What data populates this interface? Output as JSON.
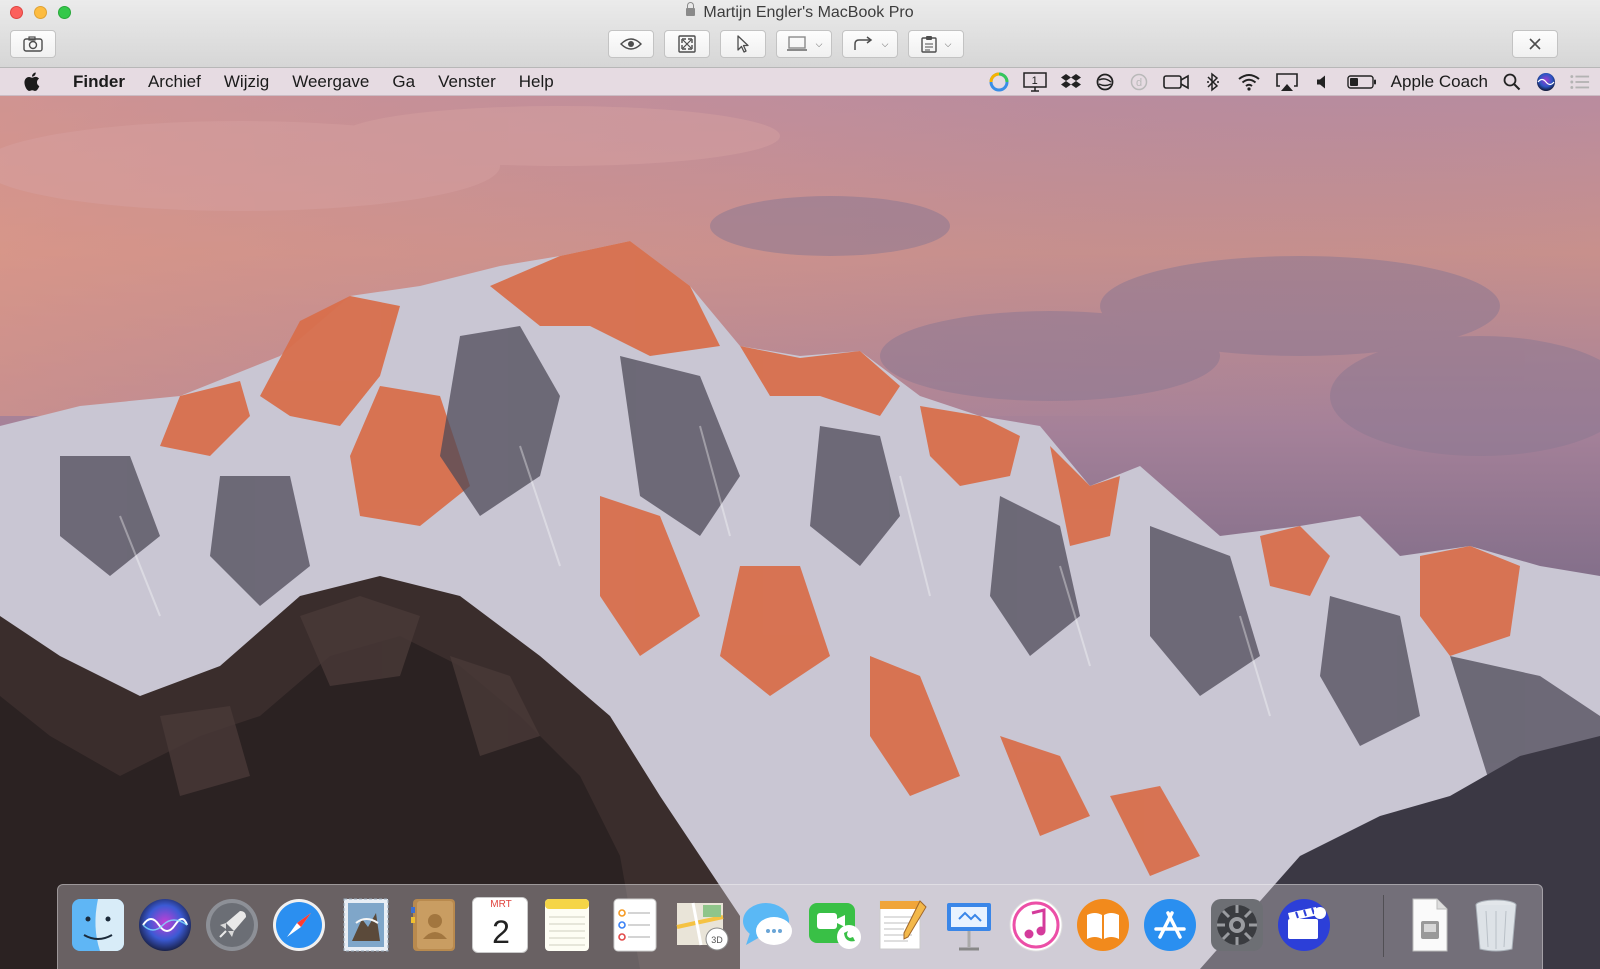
{
  "window": {
    "title": "Martijn Engler's MacBook Pro",
    "toolbar": {
      "screenshot": "camera-icon",
      "observe": "eye-icon",
      "fullscreen": "fit-screen-icon",
      "pointer": "pointer-icon",
      "display": "display-icon",
      "redirect": "redirect-icon",
      "clipboard": "clipboard-icon",
      "close": "close-icon"
    }
  },
  "menubar": {
    "apple": "",
    "items": [
      "Finder",
      "Archief",
      "Wijzig",
      "Weergave",
      "Ga",
      "Venster",
      "Help"
    ],
    "display_number": "1",
    "user": "Apple Coach"
  },
  "dock": {
    "calendar_month": "MRT",
    "calendar_day": "2",
    "apps": [
      "Finder",
      "Siri",
      "Launchpad",
      "Safari",
      "Mail",
      "Contacten",
      "Agenda",
      "Notities",
      "Herinneringen",
      "Kaarten",
      "Berichten",
      "FaceTime",
      "Pages",
      "Keynote",
      "iTunes",
      "iBooks",
      "App Store",
      "Systeemvoorkeuren",
      "Clips",
      "Documenten",
      "Prullenmand"
    ]
  },
  "colors": {
    "menubar_bg": "#eee3e9",
    "titlebar_bg": "#e4e4e4",
    "sky_pink": "#c9918f",
    "sky_violet": "#9e7f98",
    "peak_orange": "#d96f4a"
  }
}
